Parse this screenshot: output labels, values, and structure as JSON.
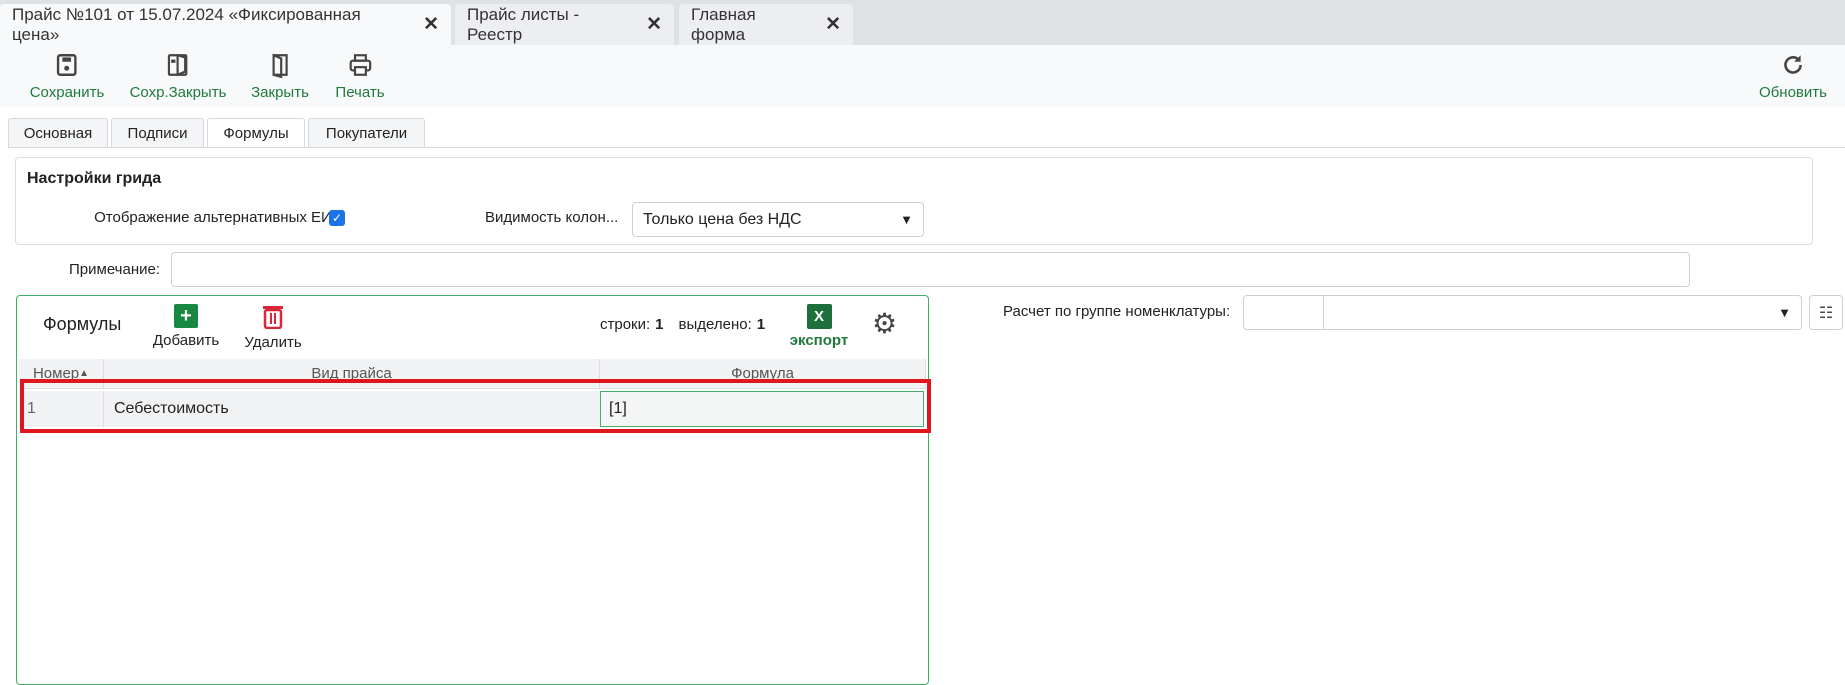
{
  "tabs": [
    {
      "label": "Прайс №101 от 15.07.2024 «Фиксированная цена»"
    },
    {
      "label": "Прайс листы - Реестр"
    },
    {
      "label": "Главная форма"
    }
  ],
  "toolbar": {
    "save": "Сохранить",
    "save_close": "Сохр.Закрыть",
    "close": "Закрыть",
    "print": "Печать",
    "refresh": "Обновить"
  },
  "subtabs": [
    "Основная",
    "Подписи",
    "Формулы",
    "Покупатели"
  ],
  "settings": {
    "title": "Настройки грида",
    "alt_units_label": "Отображение альтернативных ЕИ:",
    "alt_units_checked": true,
    "columns_label": "Видимость колон...",
    "columns_value": "Только цена без НДС"
  },
  "note": {
    "label": "Примечание:",
    "value": ""
  },
  "grid": {
    "title": "Формулы",
    "add": "Добавить",
    "delete": "Удалить",
    "rows_label": "строки:",
    "rows": "1",
    "selected_label": "выделено:",
    "selected": "1",
    "export": "экспорт",
    "export_icon": "X",
    "columns": [
      "Номер",
      "Вид прайса",
      "Формула"
    ],
    "rows_data": [
      {
        "num": "1",
        "type": "Себестоимость",
        "formula": "[1]"
      }
    ]
  },
  "group": {
    "label": "Расчет по группе номенклатуры:",
    "code": "",
    "value": ""
  },
  "colors": {
    "accent": "#1f7a3c",
    "highlight": "#e0161e",
    "delete": "#d9263a"
  }
}
